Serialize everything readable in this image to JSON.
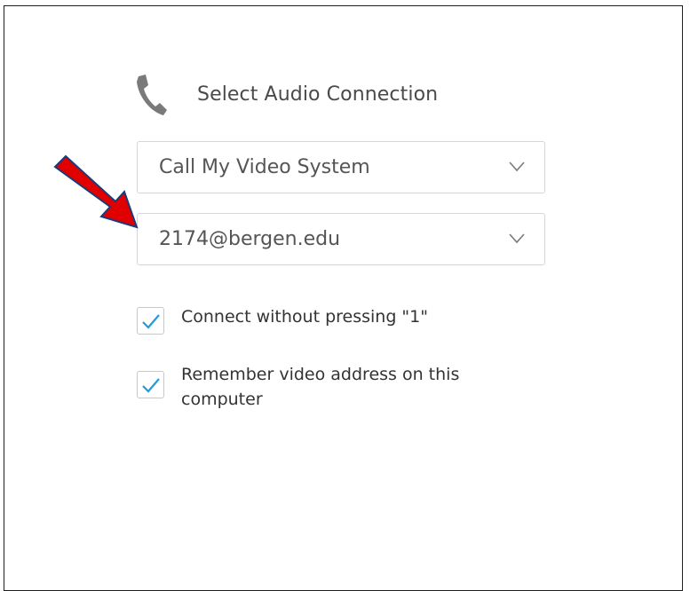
{
  "dialog": {
    "title": "Select Audio Connection",
    "icon": "phone-icon"
  },
  "audio_option_select": {
    "value": "Call My Video System"
  },
  "video_address_select": {
    "value": "2174@bergen.edu"
  },
  "options": {
    "connect_without_pressing": {
      "label": "Connect without pressing \"1\"",
      "checked": true
    },
    "remember_address": {
      "label": "Remember video address on this computer",
      "checked": true
    }
  },
  "colors": {
    "check_accent": "#1e9be0",
    "annotation_arrow": "#e00000",
    "annotation_outline": "#1a3a7a",
    "border": "#d6d6d6",
    "icon_gray": "#7a7a7a"
  }
}
